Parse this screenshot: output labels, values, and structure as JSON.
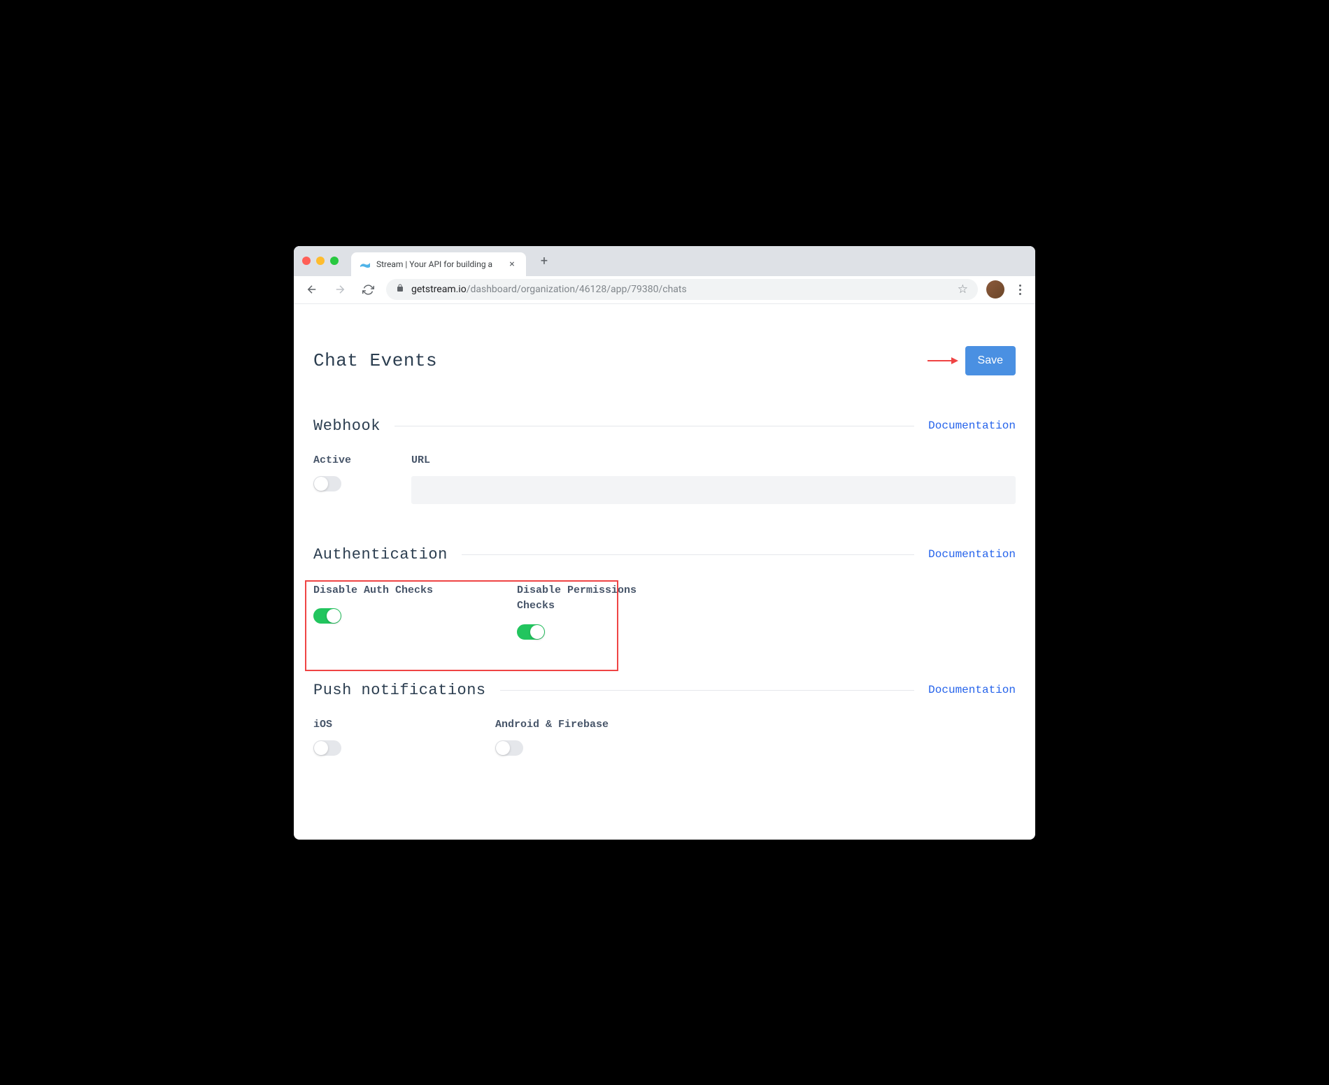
{
  "browser": {
    "tabTitle": "Stream | Your API for building a",
    "urlDomain": "getstream.io",
    "urlPath": "/dashboard/organization/46128/app/79380/chats"
  },
  "page": {
    "title": "Chat Events",
    "saveLabel": "Save"
  },
  "sections": {
    "webhook": {
      "title": "Webhook",
      "docLabel": "Documentation",
      "activeLabel": "Active",
      "urlLabel": "URL",
      "urlValue": ""
    },
    "authentication": {
      "title": "Authentication",
      "docLabel": "Documentation",
      "disableAuthLabel": "Disable Auth Checks",
      "disablePermsLabel": "Disable Permissions Checks"
    },
    "push": {
      "title": "Push notifications",
      "docLabel": "Documentation",
      "iosLabel": "iOS",
      "androidLabel": "Android & Firebase"
    }
  }
}
